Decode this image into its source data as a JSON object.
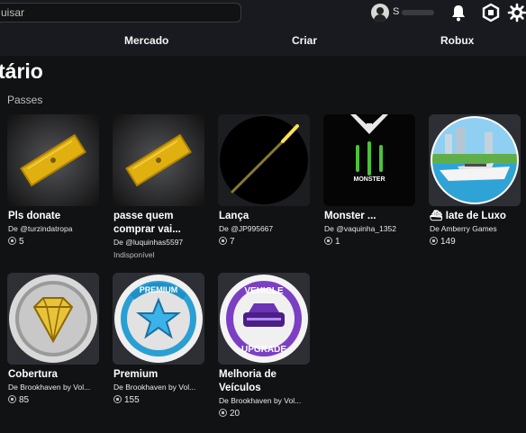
{
  "header": {
    "search_text": "uisar",
    "username": "S",
    "nav": [
      "Mercado",
      "Criar",
      "Robux"
    ]
  },
  "page": {
    "title": "tário",
    "section": "Passes"
  },
  "items": [
    {
      "name": "Pls donate",
      "creator": "De @turzindatropa",
      "price": "5",
      "status": ""
    },
    {
      "name": "passe quem comprar vai...",
      "creator": "De @luquinhas5597",
      "price": "",
      "status": "Indisponível"
    },
    {
      "name": "Lança",
      "creator": "De @JP995667",
      "price": "7",
      "status": ""
    },
    {
      "name": "Monster ...",
      "creator": "De @vaquinha_1352",
      "price": "1",
      "status": ""
    },
    {
      "name": "⛴ Iate de Luxo",
      "creator": "De Amberry Games",
      "price": "149",
      "status": ""
    },
    {
      "name": "Cobertura",
      "creator": "De Brookhaven by Vol...",
      "price": "85",
      "status": ""
    },
    {
      "name": "Premium",
      "creator": "De Brookhaven by Vol...",
      "price": "155",
      "status": ""
    },
    {
      "name": "Melhoria de Veículos",
      "creator": "De Brookhaven by Vol...",
      "price": "20",
      "status": ""
    }
  ],
  "thumb_text": {
    "monster": "MONSTER",
    "premium": "PREMIUM",
    "vehicle": "VEHICLE",
    "upgrade": "UPGRADE"
  },
  "icons": [
    "user-avatar",
    "bell-icon",
    "robux-icon",
    "gear-icon",
    "robux-coin-icon"
  ],
  "colors": {
    "background": "#111214",
    "topbar": "#191a1f",
    "text": "#f2f4f5",
    "muted": "#bdbebe"
  }
}
